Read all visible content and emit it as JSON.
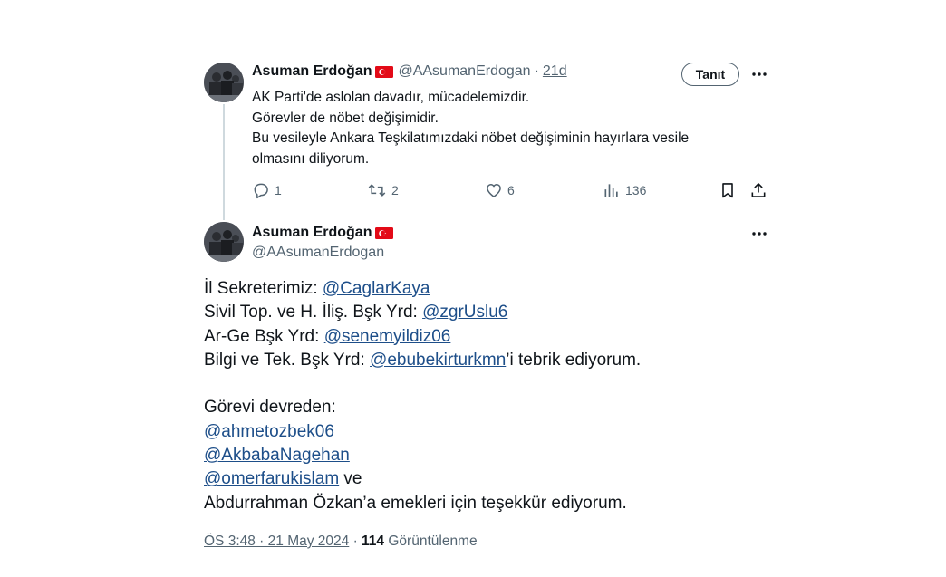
{
  "reply_tweet": {
    "author_name": "Asuman Erdoğan",
    "handle": "@AAsumanErdogan",
    "separator": "·",
    "time_ago": "21d",
    "follow_label": "Tanıt",
    "lines": [
      "AK Parti'de aslolan davadır, mücadelemizdir.",
      "Görevler de nöbet değişimidir.",
      "Bu vesileyle Ankara Teşkilatımızdaki nöbet değişiminin hayırlara vesile",
      "olmasını diliyorum."
    ],
    "actions": {
      "reply_count": "1",
      "retweet_count": "2",
      "like_count": "6",
      "views_count": "136"
    },
    "icons": [
      "reply-icon",
      "retweet-icon",
      "like-icon",
      "views-icon",
      "bookmark-icon",
      "share-icon",
      "more-icon"
    ]
  },
  "main_tweet": {
    "author_name": "Asuman Erdoğan",
    "handle": "@AAsumanErdogan",
    "body": {
      "l1_text": "İl Sekreterimiz: ",
      "l1_link": "@CaglarKaya",
      "l2_text": "Sivil Top. ve H. İliş. Bşk Yrd: ",
      "l2_link": "@zgrUslu6",
      "l3_text": "Ar-Ge Bşk Yrd: ",
      "l3_link": "@senemyildiz06",
      "l4_text": "Bilgi ve Tek. Bşk Yrd: ",
      "l4_link": "@ebubekirturkmn",
      "l4_suffix": "’i tebrik ediyorum.",
      "l6_text": "Görevi devreden:",
      "l7_link": "@ahmetozbek06",
      "l8_link": "@AkbabaNagehan",
      "l9_link": "@omerfarukislam",
      "l9_suffix": " ve",
      "l10_text": "Abdurrahman Özkan’a emekleri için teşekkür ediyorum."
    },
    "meta": {
      "timestamp": "ÖS 3:48 · 21 May 2024",
      "separator": " · ",
      "views": "114",
      "views_label": " Görüntülenme"
    }
  },
  "colors": {
    "link": "#1d4e89",
    "muted": "#536471",
    "text": "#0f1419",
    "flag_red": "#e30a17"
  }
}
